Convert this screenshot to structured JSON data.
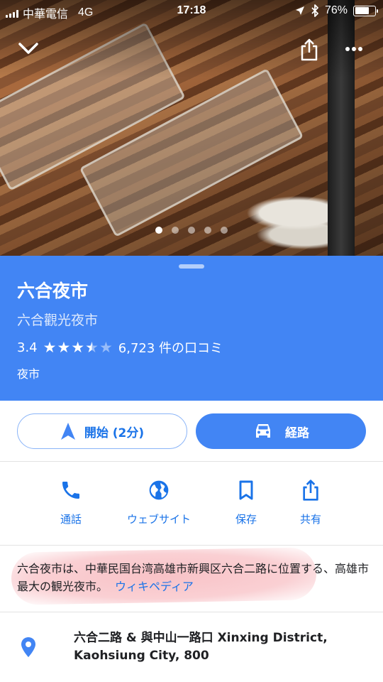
{
  "status_bar": {
    "carrier": "中華電信",
    "network": "4G",
    "time": "17:18",
    "battery_percent": "76%",
    "battery_level": 0.76
  },
  "photo": {
    "image_count": 5,
    "active_index": 0,
    "icons": {
      "back": "chevron-down-icon",
      "share": "share-icon",
      "more": "more-icon"
    }
  },
  "place": {
    "name": "六合夜市",
    "alt_name": "六合觀光夜市",
    "rating": "3.4",
    "rating_value": 3.4,
    "review_count": "6,723 件の口コミ",
    "category": "夜市"
  },
  "actions": {
    "start_label": "開始 (2分)",
    "route_label": "経路"
  },
  "quick_actions": [
    {
      "label": "通話",
      "icon": "phone-icon"
    },
    {
      "label": "ウェブサイト",
      "icon": "globe-icon"
    },
    {
      "label": "保存",
      "icon": "bookmark-icon"
    },
    {
      "label": "共有",
      "icon": "share-icon"
    }
  ],
  "description": {
    "text": "六合夜市は、中華民国台湾高雄市新興区六合二路に位置する、高雄市最大の観光夜市。",
    "link": "ウィキペディア"
  },
  "address": {
    "text": "六合二路 & 與中山一路口 Xinxing District, Kaohsiung City, 800"
  },
  "colors": {
    "accent": "#4285f4",
    "link": "#1a73e8",
    "highlight": "#f07882"
  }
}
